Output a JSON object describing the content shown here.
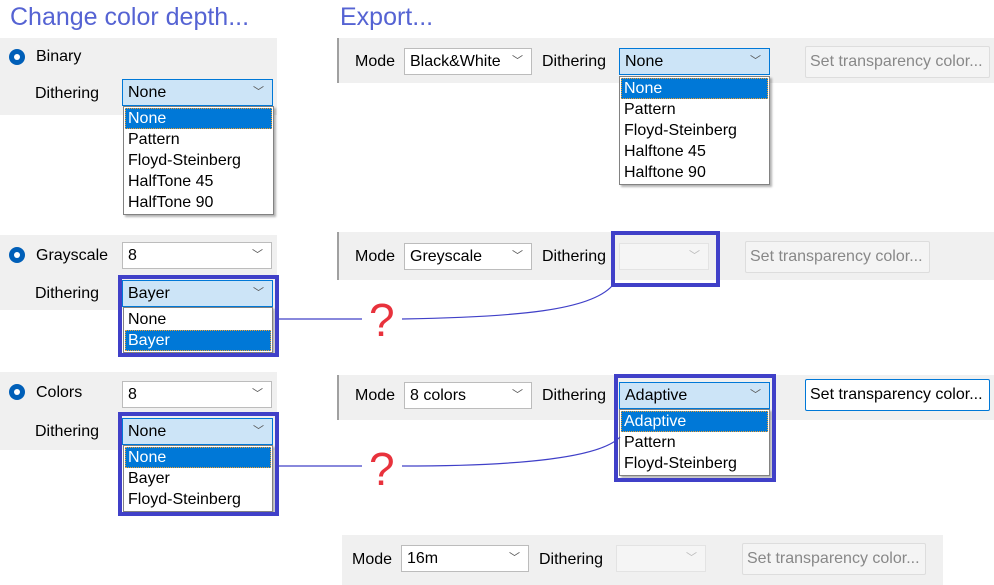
{
  "titles": {
    "left": "Change color depth...",
    "right": "Export..."
  },
  "left": {
    "binary": {
      "label": "Binary",
      "dithering_label": "Dithering",
      "dithering_value": "None",
      "options": [
        "None",
        "Pattern",
        "Floyd-Steinberg",
        "HalfTone 45",
        "HalfTone 90"
      ]
    },
    "grayscale": {
      "label": "Grayscale",
      "depth_value": "8",
      "dithering_label": "Dithering",
      "dithering_value": "Bayer",
      "options": [
        "None",
        "Bayer"
      ]
    },
    "colors": {
      "label": "Colors",
      "depth_value": "8",
      "dithering_label": "Dithering",
      "dithering_value": "None",
      "options": [
        "None",
        "Bayer",
        "Floyd-Steinberg"
      ]
    }
  },
  "right": {
    "bw": {
      "mode_label": "Mode",
      "mode_value": "Black&White",
      "dithering_label": "Dithering",
      "dithering_value": "None",
      "options": [
        "None",
        "Pattern",
        "Floyd-Steinberg",
        "Halftone 45",
        "Halftone 90"
      ],
      "button": "Set transparency color..."
    },
    "grey": {
      "mode_label": "Mode",
      "mode_value": "Greyscale",
      "dithering_label": "Dithering",
      "dithering_value": "",
      "button": "Set transparency color..."
    },
    "colors8": {
      "mode_label": "Mode",
      "mode_value": "8 colors",
      "dithering_label": "Dithering",
      "dithering_value": "Adaptive",
      "options": [
        "Adaptive",
        "Pattern",
        "Floyd-Steinberg"
      ],
      "button": "Set transparency color..."
    },
    "m16": {
      "mode_label": "Mode",
      "mode_value": "16m",
      "dithering_label": "Dithering",
      "dithering_value": "",
      "button": "Set transparency color..."
    }
  },
  "annotations": {
    "question": "?"
  },
  "colors": {
    "highlight": "#4040c8",
    "question": "#e8323c",
    "title": "#5563d3"
  }
}
